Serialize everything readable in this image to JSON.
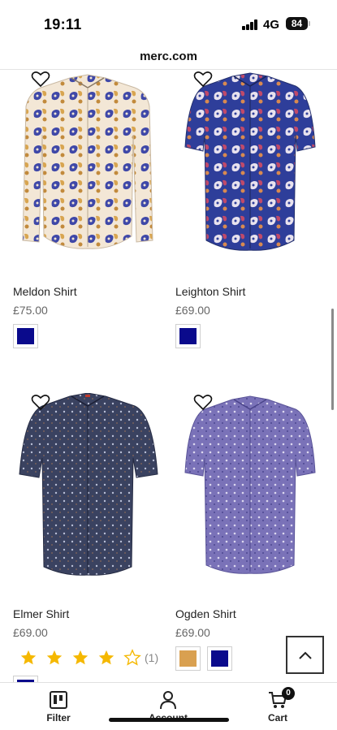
{
  "status_bar": {
    "time": "19:11",
    "network": "4G",
    "battery": "84"
  },
  "browser": {
    "url": "merc.com"
  },
  "products": [
    {
      "name": "Meldon Shirt",
      "price": "£75.00",
      "image_icon": "paisley-long-sleeve-shirt",
      "swatches": [
        "#0a0a8c"
      ]
    },
    {
      "name": "Leighton Shirt",
      "price": "£69.00",
      "image_icon": "paisley-short-sleeve-shirt",
      "swatches": [
        "#0a0a8c"
      ]
    },
    {
      "name": "Elmer Shirt",
      "price": "£69.00",
      "image_icon": "navy-print-short-sleeve-shirt",
      "rating": {
        "stars": 4,
        "max": 5,
        "count": "(1)"
      },
      "swatches": [
        "#0a0a8c"
      ]
    },
    {
      "name": "Ogden Shirt",
      "price": "£69.00",
      "image_icon": "purple-print-short-sleeve-shirt",
      "swatches": [
        "#d9a050",
        "#0a0a8c"
      ]
    }
  ],
  "colors": {
    "star": "#f5b800",
    "accent": "#0a0a8c"
  },
  "nav": {
    "filter": {
      "label": "Filter",
      "icon": "filter-icon"
    },
    "account": {
      "label": "Account",
      "icon": "person-icon"
    },
    "cart": {
      "label": "Cart",
      "icon": "cart-icon",
      "count": "0"
    }
  },
  "back_to_top_icon": "chevron-up-icon"
}
